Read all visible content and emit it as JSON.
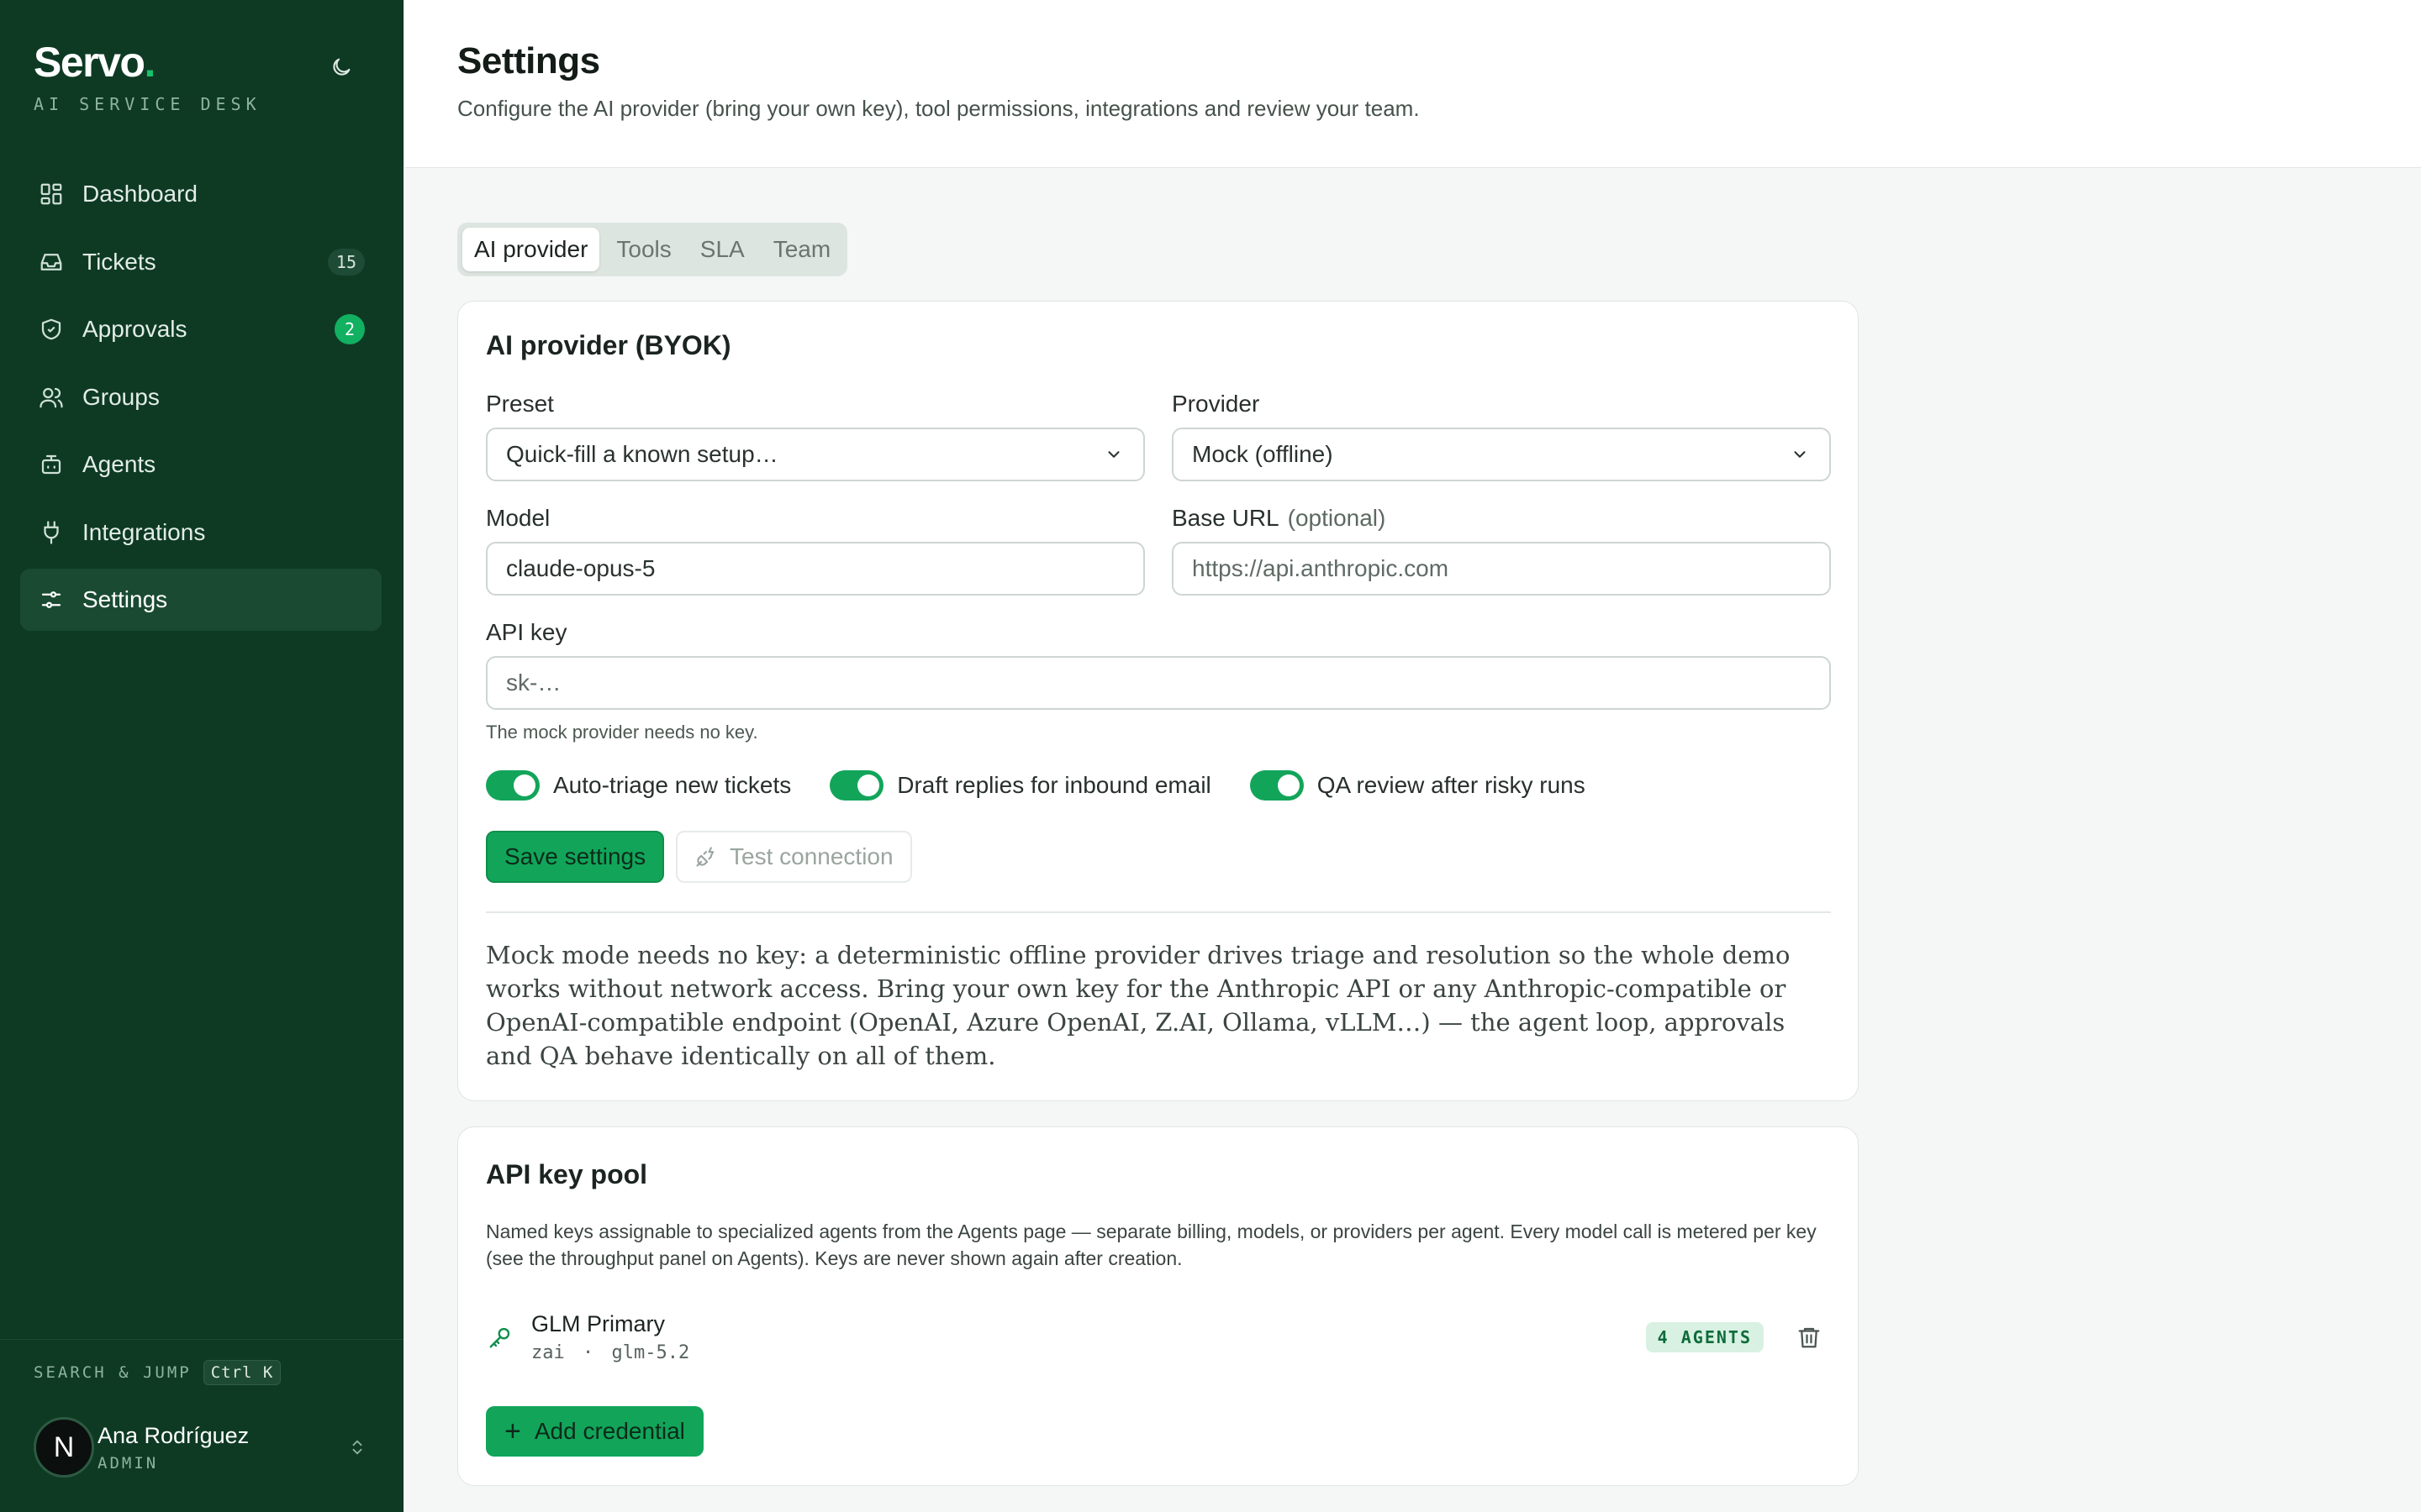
{
  "app": {
    "name": "Servo",
    "dot": ".",
    "subtitle": "AI SERVICE DESK"
  },
  "sidebar": {
    "items": [
      {
        "label": "Dashboard",
        "icon": "dashboard-icon"
      },
      {
        "label": "Tickets",
        "icon": "inbox-icon",
        "badge": "15"
      },
      {
        "label": "Approvals",
        "icon": "shield-check-icon",
        "badge": "2"
      },
      {
        "label": "Groups",
        "icon": "users-icon"
      },
      {
        "label": "Agents",
        "icon": "bot-icon"
      },
      {
        "label": "Integrations",
        "icon": "plug-icon"
      },
      {
        "label": "Settings",
        "icon": "sliders-icon",
        "active": true
      }
    ],
    "search": {
      "label": "SEARCH & JUMP",
      "shortcut": "Ctrl K"
    },
    "user": {
      "initial": "N",
      "name": "Ana Rodríguez",
      "role": "ADMIN"
    }
  },
  "header": {
    "title": "Settings",
    "subtitle": "Configure the AI provider (bring your own key), tool permissions, integrations and review your team."
  },
  "tabs": [
    {
      "label": "AI provider",
      "active": true
    },
    {
      "label": "Tools"
    },
    {
      "label": "SLA"
    },
    {
      "label": "Team"
    }
  ],
  "provider_card": {
    "title": "AI provider (BYOK)",
    "preset": {
      "label": "Preset",
      "value": "Quick-fill a known setup…"
    },
    "provider": {
      "label": "Provider",
      "value": "Mock (offline)"
    },
    "model": {
      "label": "Model",
      "value": "claude-opus-5"
    },
    "base_url": {
      "label": "Base URL",
      "optional": "(optional)",
      "placeholder": "https://api.anthropic.com"
    },
    "api_key": {
      "label": "API key",
      "placeholder": "sk-…",
      "help": "The mock provider needs no key."
    },
    "toggles": [
      {
        "label": "Auto-triage new tickets",
        "on": true
      },
      {
        "label": "Draft replies for inbound email",
        "on": true
      },
      {
        "label": "QA review after risky runs",
        "on": true
      }
    ],
    "save_label": "Save settings",
    "test_label": "Test connection",
    "note": "Mock mode needs no key: a deterministic offline provider drives triage and resolution so the whole demo works without network access. Bring your own key for the Anthropic API or any Anthropic-compatible or OpenAI-compatible endpoint (OpenAI, Azure OpenAI, Z.AI, Ollama, vLLM…) — the agent loop, approvals and QA behave identically on all of them."
  },
  "key_pool": {
    "title": "API key pool",
    "description": "Named keys assignable to specialized agents from the Agents page — separate billing, models, or providers per agent. Every model call is metered per key (see the throughput panel on Agents). Keys are never shown again after creation.",
    "credentials": [
      {
        "name": "GLM Primary",
        "provider": "zai",
        "sep": "·",
        "model": "glm-5.2",
        "badge": "4 AGENTS"
      }
    ],
    "add_label": "Add credential"
  },
  "colors": {
    "sidebar_bg": "#0e3a24",
    "accent": "#12a55a",
    "brand_dot": "#19c06a"
  }
}
